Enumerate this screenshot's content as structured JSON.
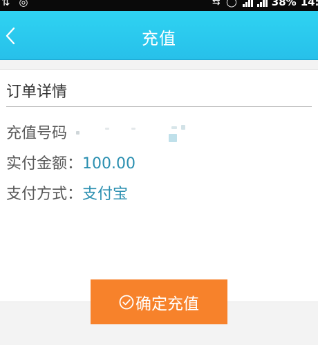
{
  "status_bar": {
    "left_icons": "⇅ ◎",
    "right_icons": "⇆ ◯",
    "battery_percent": "38%",
    "time": "14:1"
  },
  "header": {
    "title": "充值",
    "back_icon": "chevron-left-icon",
    "background_color": "#2fd3f2"
  },
  "order": {
    "section_title": "订单详情",
    "recharge_number_label": "充值号码",
    "amount_label": "实付金额：",
    "amount_value": "100.00",
    "payment_method_label": "支付方式：",
    "payment_method_value": "支付宝"
  },
  "confirm_button": {
    "icon": "check-circle-icon",
    "label": "确定充值",
    "color": "#f7822b"
  }
}
